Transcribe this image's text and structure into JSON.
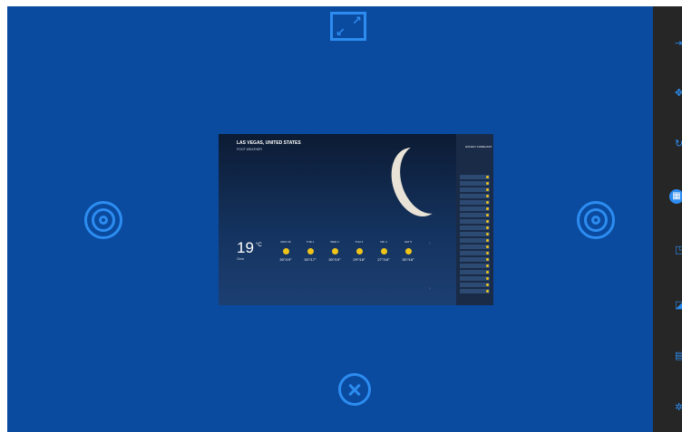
{
  "window": {
    "right_icons": [
      "sign-in-icon",
      "move-icon",
      "refresh-icon",
      "calendar-icon",
      "trash-icon",
      "tag-icon",
      "grid-icon",
      "settings-icon"
    ]
  },
  "controls": {
    "expand_icon": "expand-icon",
    "left_target": "target-icon",
    "right_target": "target-icon",
    "close_icon": "close-circle-icon"
  },
  "thumbnail": {
    "city": "LAS VEGAS, UNITED STATES",
    "source": "FOOT WEATHER",
    "temperature": "19",
    "unit": "°C",
    "conditions": "Clear",
    "sidebar_header": "HOURLY FORECAST",
    "forecast": [
      {
        "day": "MON 30",
        "range": "30°/19°"
      },
      {
        "day": "TUE 1",
        "range": "30°/17°"
      },
      {
        "day": "WED 2",
        "range": "30°/19°"
      },
      {
        "day": "THU 3",
        "range": "29°/18°"
      },
      {
        "day": "FRI 4",
        "range": "27°/18°"
      },
      {
        "day": "SAT 5",
        "range": "30°/18°"
      }
    ]
  },
  "colors": {
    "stage": "#0a4a9f",
    "accent": "#2d8cf0",
    "sidebar": "#262626"
  }
}
